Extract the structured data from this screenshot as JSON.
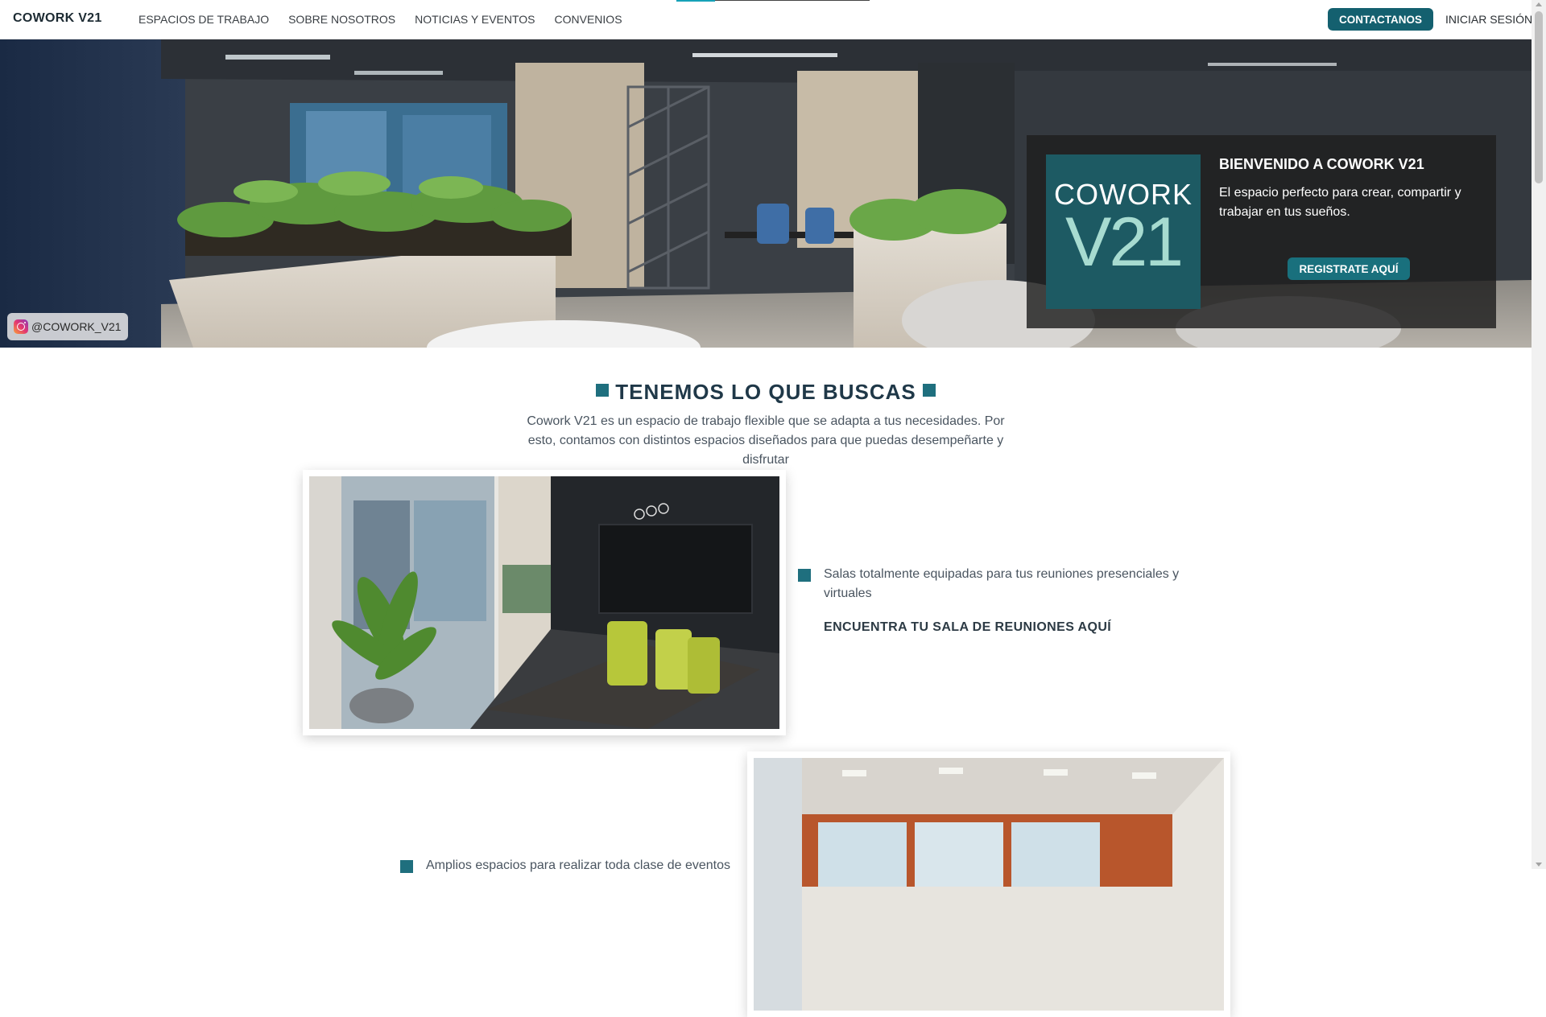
{
  "navbar": {
    "brand": "COWORK V21",
    "links": [
      "ESPACIOS DE TRABAJO",
      "SOBRE NOSOTROS",
      "NOTICIAS Y EVENTOS",
      "CONVENIOS"
    ],
    "contact_label": "CONTACTANOS",
    "login_label": "INICIAR SESIÓN",
    "accent_color": "#14606f"
  },
  "hero": {
    "instagram_handle": "@COWORK_V21",
    "logo_line1": "COWORK",
    "logo_line2": "V21",
    "welcome_title": "BIENVENIDO A COWORK V21",
    "welcome_text": "El espacio perfecto para crear, compartir y trabajar en tus sueños.",
    "register_label": "REGISTRATE AQUÍ"
  },
  "section": {
    "title": "TENEMOS LO QUE BUSCAS",
    "description": "Cowork V21 es un espacio de trabajo flexible que se adapta a tus necesidades. Por esto, contamos con distintos espacios diseñados para que puedas desempeñarte y disfrutar",
    "features": [
      {
        "text": "Salas totalmente equipadas para tus reuniones presenciales y virtuales",
        "link": "ENCUENTRA TU SALA DE REUNIONES AQUÍ"
      },
      {
        "text": "Amplios espacios para realizar toda clase de eventos"
      }
    ]
  },
  "colors": {
    "brand_teal": "#1d5a63",
    "logo_mint": "#a7dbd0",
    "bullet_teal": "#1f6f7e",
    "title_navy": "#1f3848"
  }
}
